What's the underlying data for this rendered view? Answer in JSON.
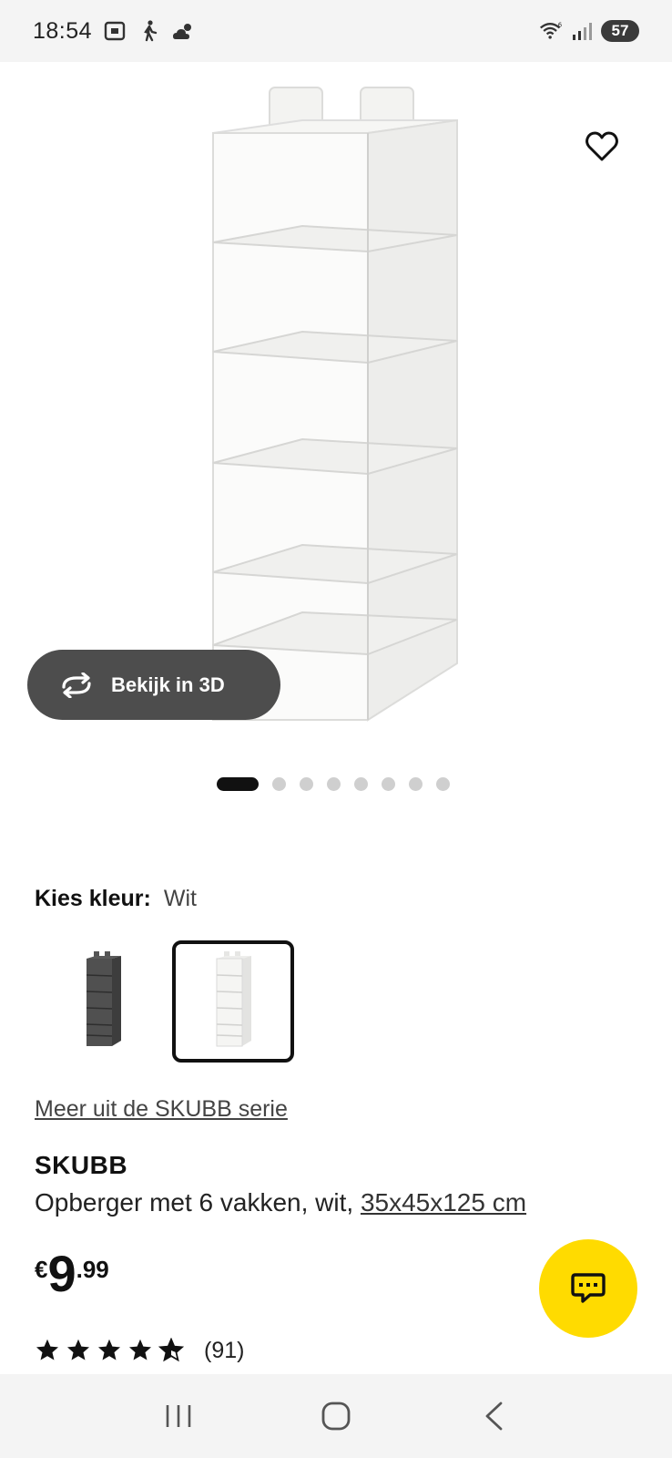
{
  "status_bar": {
    "time": "18:54",
    "icons": [
      "screenshot-icon",
      "walking-icon",
      "weather-icon"
    ],
    "right_icons": [
      "wifi-icon",
      "signal-icon"
    ],
    "battery": "57"
  },
  "hero": {
    "favorite_icon": "heart-icon",
    "view3d_label": "Bekijk in 3D",
    "view3d_icon": "rotate-icon",
    "pagination": {
      "total": 8,
      "current": 1
    }
  },
  "color": {
    "label": "Kies kleur:",
    "value": "Wit",
    "swatches": [
      {
        "name": "donkergrijs",
        "color": "#4a4a4a",
        "selected": false
      },
      {
        "name": "wit",
        "color": "#eeeeee",
        "selected": true
      }
    ]
  },
  "series_link": "Meer uit de SKUBB serie",
  "product": {
    "name": "SKUBB",
    "description": "Opberger met 6 vakken, wit,",
    "dimensions": "35x45x125 cm"
  },
  "price": {
    "currency": "€",
    "main": "9",
    "cents": ".99"
  },
  "rating": {
    "stars": 4.5,
    "count": "(91)"
  },
  "chat_fab_icon": "chat-icon",
  "nav": {
    "recents": "recents-icon",
    "home": "home-icon",
    "back": "back-icon"
  },
  "colors": {
    "accent_yellow": "#ffdb00",
    "button_dark": "#4d4d4d",
    "text": "#111111"
  }
}
